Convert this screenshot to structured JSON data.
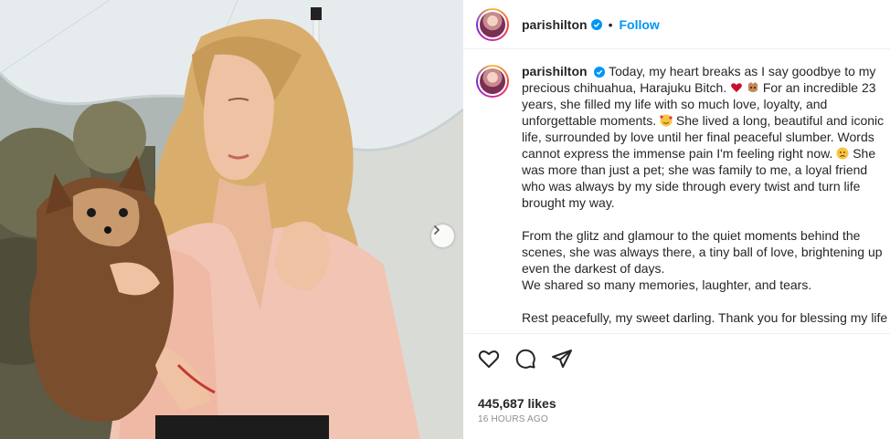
{
  "header": {
    "username": "parishilton",
    "dot": "•",
    "follow_label": "Follow"
  },
  "caption": {
    "username": "parishilton",
    "lines": [
      "Today, my heart breaks as I say goodbye to my",
      "precious chihuahua, Harajuku Bitch.",
      "For an incredible 23",
      "years, she filled my life with so much love, loyalty, and",
      "unforgettable moments.",
      "She lived a long, beautiful and iconic",
      "life, surrounded by love until her final peaceful slumber. Words",
      "cannot express the immense pain I'm feeling right now.",
      "She",
      "was more than just a pet; she was family to me, a loyal friend",
      "who was always by my side through every twist and turn life",
      "brought my way.",
      "From the glitz and glamour to the quiet moments behind the",
      "scenes, she was always there, a tiny ball of love, brightening up",
      "even the darkest of days.",
      "We shared so many memories, laughter, and tears.",
      "Rest peacefully, my sweet darling. Thank you for blessing my life"
    ]
  },
  "actions": {
    "likes": "445,687 likes",
    "time": "16 HOURS AGO"
  },
  "icons": {
    "like": "heart-icon",
    "comment": "comment-icon",
    "share": "share-icon",
    "verified": "verified-badge-icon",
    "next": "chevron-right-icon"
  },
  "colors": {
    "accent": "#0095f6",
    "text": "#262626",
    "muted": "#8e8e8e"
  }
}
